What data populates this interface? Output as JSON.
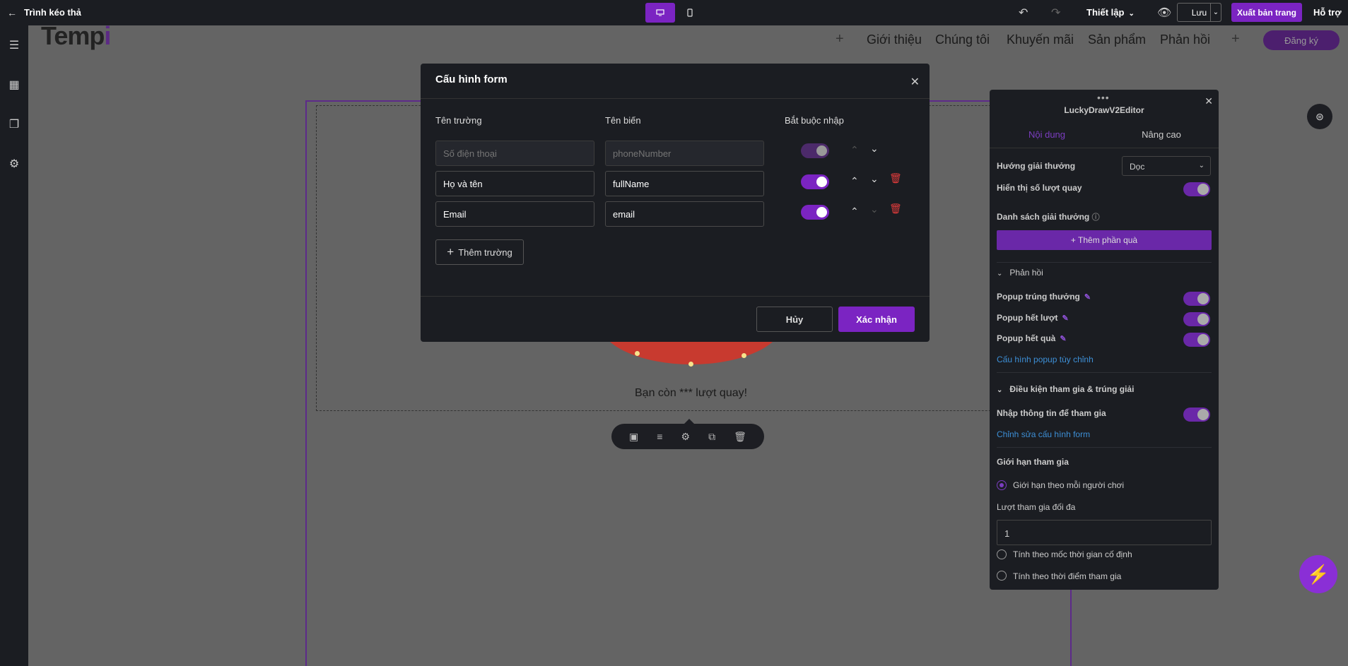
{
  "topbar": {
    "back_icon": "arrow-left-icon",
    "title": "Trình kéo thả",
    "setup_label": "Thiết lập",
    "save_label": "Lưu",
    "export_label": "Xuất bản trang",
    "help_label": "Hỗ trợ"
  },
  "site": {
    "logo_text": "Temp",
    "logo_accent": "i",
    "nav": [
      "Giới thiệu",
      "Chúng tôi",
      "Khuyến mãi",
      "Sản phẩm",
      "Phản hồi"
    ],
    "register_label": "Đăng ký",
    "spin_text": "Bạn còn *** lượt quay!"
  },
  "panel": {
    "title": "LuckyDrawV2Editor",
    "tab_content": "Nội dung",
    "tab_advanced": "Nâng cao",
    "prize_direction_label": "Hướng giải thưởng",
    "prize_direction_value": "Dọc",
    "show_spins_label": "Hiển thị số lượt quay",
    "prize_list_label": "Danh sách giải thưởng",
    "add_prize_label": "+ Thêm phần quà",
    "feedback_section": "Phản hồi",
    "popup_win_label": "Popup trúng thưởng",
    "popup_out_of_turns_label": "Popup hết lượt",
    "popup_out_of_prizes_label": "Popup hết quà",
    "custom_popup_link": "Cấu hình popup tùy chỉnh",
    "conditions_section": "Điều kiện tham gia & trúng giải",
    "enter_info_label": "Nhập thông tin để tham gia",
    "edit_form_link": "Chỉnh sửa cấu hình form",
    "limit_title": "Giới hạn tham gia",
    "limit_per_player": "Giới hạn theo mỗi người chơi",
    "max_entries_label": "Lượt tham gia đối đa",
    "max_entries_value": "1",
    "by_fixed_time": "Tính theo mốc thời gian cố định",
    "by_join_time": "Tính theo thời điểm tham gia"
  },
  "modal": {
    "title": "Cấu hình form",
    "col_field": "Tên trường",
    "col_variable": "Tên biến",
    "col_required": "Bắt buộc nhập",
    "rows": [
      {
        "field_placeholder": "Số điện thoại",
        "var_placeholder": "phoneNumber",
        "field": "",
        "variable": ""
      },
      {
        "field": "Họ và tên",
        "variable": "fullName"
      },
      {
        "field": "Email",
        "variable": "email"
      }
    ],
    "add_field_label": "Thêm trường",
    "cancel_label": "Hủy",
    "confirm_label": "Xác nhận"
  },
  "colors": {
    "accent": "#7b24c2",
    "link": "#3d8fd6",
    "danger": "#e03b3b"
  }
}
